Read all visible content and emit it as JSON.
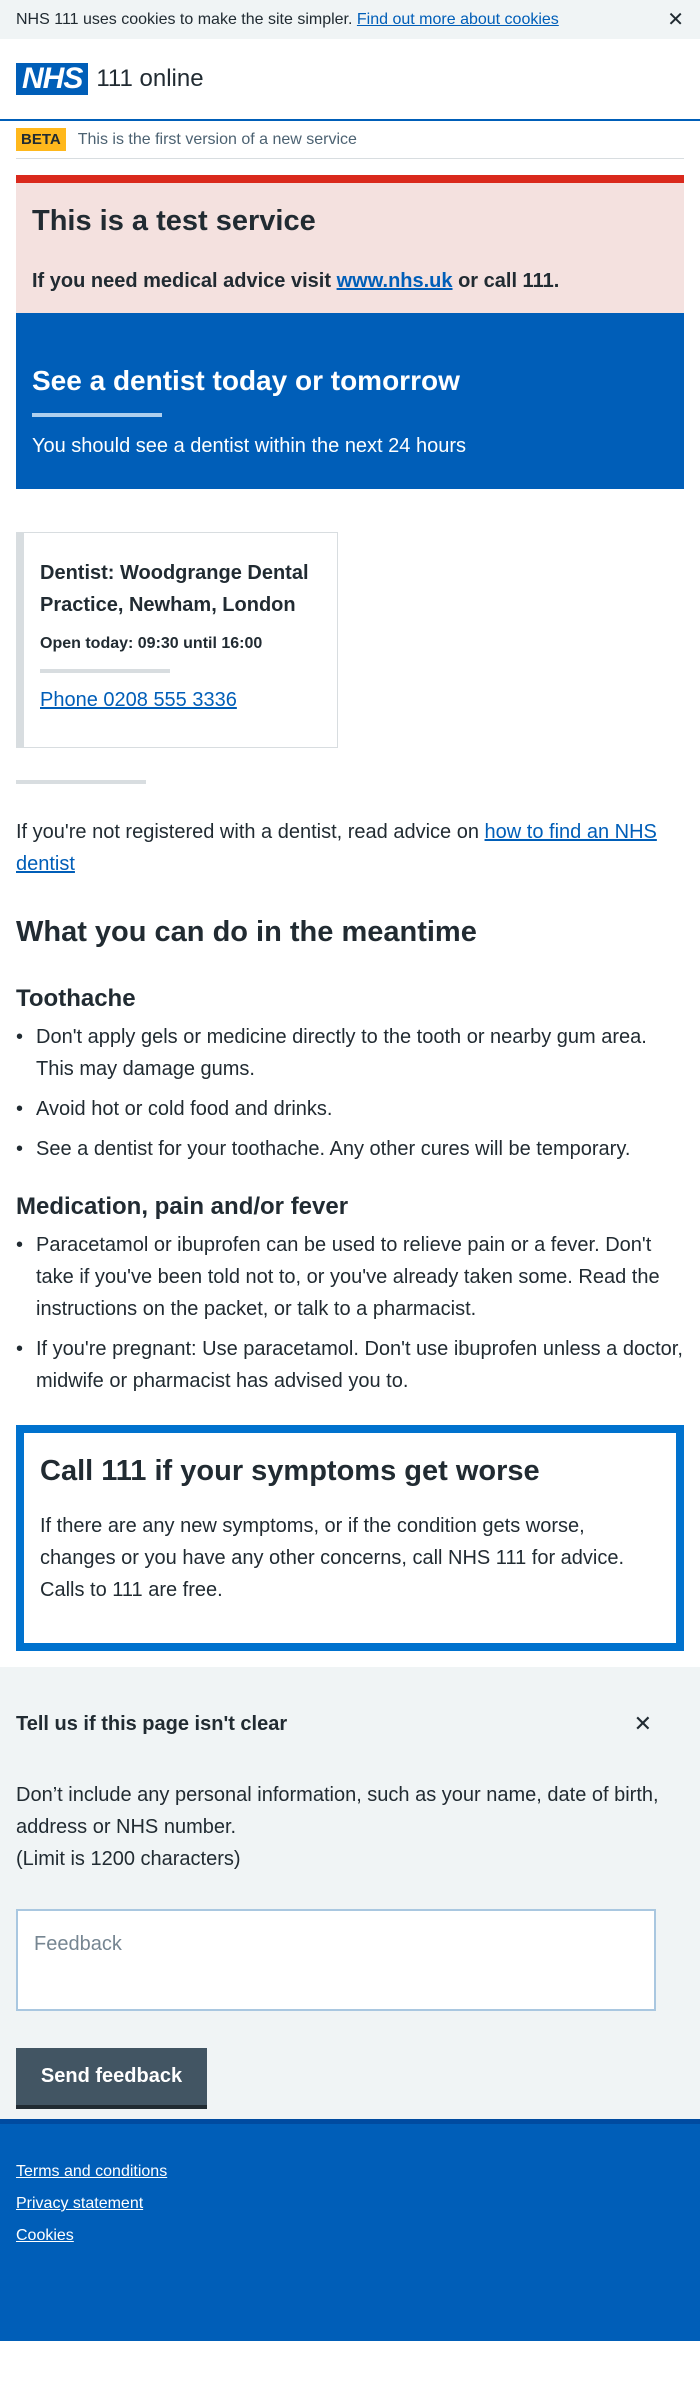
{
  "cookie_banner": {
    "text": "NHS 111 uses cookies to make the site simpler.",
    "link": "Find out more about cookies",
    "close": "✕"
  },
  "header": {
    "logo": "NHS",
    "service": "111 online"
  },
  "beta": {
    "tag": "BETA",
    "text": "This is the first version of a new service"
  },
  "test_notice": {
    "title": "This is a test service",
    "text_before": "If you need medical advice visit",
    "link": "www.nhs.uk",
    "text_after": "or call 111."
  },
  "outcome": {
    "title": "See a dentist today or tomorrow",
    "subtitle": "You should see a dentist within the next 24 hours"
  },
  "service_card": {
    "name": "Dentist: Woodgrange Dental Practice, Newham, London",
    "hours": "Open today: 09:30 until 16:00",
    "phone": "Phone 0208 555 3336"
  },
  "registration": {
    "text": "If you're not registered with a dentist, read advice on",
    "link": "how to find an NHS dentist"
  },
  "meantime": {
    "title": "What you can do in the meantime",
    "sections": [
      {
        "title": "Toothache",
        "items": [
          "Don't apply gels or medicine directly to the tooth or nearby gum area. This may damage gums.",
          "Avoid hot or cold food and drinks.",
          "See a dentist for your toothache. Any other cures will be temporary."
        ]
      },
      {
        "title": "Medication, pain and/or fever",
        "items": [
          "Paracetamol or ibuprofen can be used to relieve pain or a fever. Don't take if you've been told not to, or you've already taken some. Read the instructions on the packet, or talk to a pharmacist.",
          "If you're pregnant: Use paracetamol. Don't use ibuprofen unless a doctor, midwife or pharmacist has advised you to."
        ]
      }
    ]
  },
  "worse_card": {
    "title": "Call 111 if your symptoms get worse",
    "text": "If there are any new symptoms, or if the condition gets worse, changes or you have any other concerns, call NHS 111 for advice. Calls to 111 are free."
  },
  "feedback": {
    "title": "Tell us if this page isn't clear",
    "close": "✕",
    "info": "Don’t include any personal information, such as your name, date of birth, address or NHS number.",
    "limit": "(Limit is 1200 characters)",
    "placeholder": "Feedback",
    "button": "Send feedback"
  },
  "footer": {
    "links": [
      "Terms and conditions",
      "Privacy statement",
      "Cookies"
    ]
  },
  "colors": {
    "nhs_blue": "#005eb8",
    "test_red": "#da291c",
    "beta_yellow": "#ffb81c",
    "panel_pink": "#f4e1df",
    "grey_bg": "#f0f4f5"
  }
}
